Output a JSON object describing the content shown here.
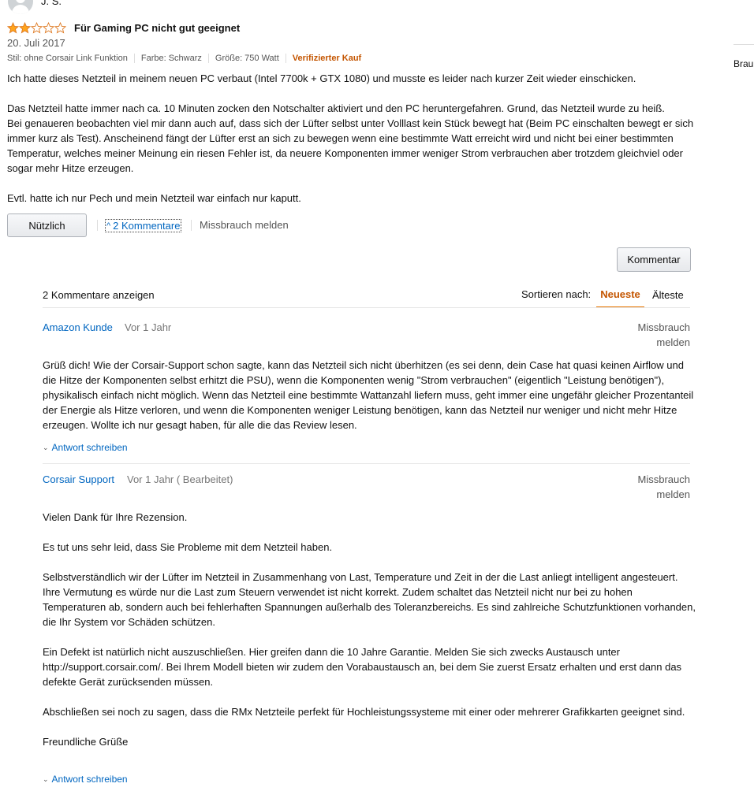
{
  "review": {
    "author": "J. S.",
    "rating": 2,
    "rating_max": 5,
    "title": "Für Gaming PC nicht gut geeignet",
    "date": "20. Juli 2017",
    "meta": {
      "style": "Stil: ohne Corsair Link Funktion",
      "color": "Farbe: Schwarz",
      "size": "Größe: 750 Watt",
      "verified": "Verifizierter Kauf"
    },
    "paragraphs": [
      "Ich hatte dieses Netzteil in meinem neuen PC verbaut (Intel 7700k + GTX 1080) und musste es leider nach kurzer Zeit wieder einschicken.",
      "Das Netzteil hatte immer nach ca. 10 Minuten zocken den Notschalter aktiviert und den PC heruntergefahren. Grund, das Netzteil wurde zu heiß.\nBei genaueren beobachten viel mir dann auch auf, dass sich der Lüfter selbst unter Volllast kein Stück bewegt hat (Beim PC einschalten bewegt er sich immer kurz als Test). Anscheinend fängt der Lüfter erst an sich zu bewegen wenn eine bestimmte Watt erreicht wird und nicht bei einer bestimmten Temperatur, welches meiner Meinung ein riesen Fehler ist, da neuere Komponenten immer weniger Strom verbrauchen aber trotzdem gleichviel oder sogar mehr Hitze erzeugen.",
      "Evtl. hatte ich nur Pech und mein Netzteil war einfach nur kaputt."
    ],
    "helpful_label": "Nützlich",
    "comments_link": "2 Kommentare",
    "report_label": "Missbrauch melden",
    "comment_button": "Kommentar"
  },
  "sidebar": {
    "partial_text": "Brau"
  },
  "comments_section": {
    "count_label": "2 Kommentare anzeigen",
    "sort_label": "Sortieren nach:",
    "sort_newest": "Neueste",
    "sort_oldest": "Älteste",
    "comments": [
      {
        "author": "Amazon Kunde",
        "time": "Vor 1 Jahr",
        "report_line1": "Missbrauch",
        "report_line2": "melden",
        "paragraphs": [
          "Grüß dich! Wie der Corsair-Support schon sagte, kann das Netzteil sich nicht überhitzen (es sei denn, dein Case hat quasi keinen Airflow und die Hitze der Komponenten selbst erhitzt die PSU), wenn die Komponenten wenig \"Strom verbrauchen\" (eigentlich \"Leistung benötigen\"), physikalisch einfach nicht möglich. Wenn das Netzteil eine bestimmte Wattanzahl liefern muss, geht immer eine ungefähr gleicher Prozentanteil der Energie als Hitze verloren, und wenn die Komponenten weniger Leistung benötigen, kann das Netzteil nur weniger und nicht mehr Hitze erzeugen. Wollte ich nur gesagt haben, für alle die das Review lesen."
        ],
        "reply_label": "Antwort schreiben"
      },
      {
        "author": "Corsair Support",
        "time": "Vor 1 Jahr ( Bearbeitet)",
        "report_line1": "Missbrauch",
        "report_line2": "melden",
        "paragraphs": [
          "Vielen Dank für Ihre Rezension.",
          "Es tut uns sehr leid, dass Sie Probleme mit dem Netzteil haben.",
          "Selbstverständlich wir der Lüfter im Netzteil in Zusammenhang von Last, Temperature und Zeit in der die Last anliegt intelligent angesteuert. Ihre Vermutung es würde nur die Last zum Steuern verwendet ist nicht korrekt. Zudem schaltet das Netzteil nicht nur bei zu hohen Temperaturen ab, sondern auch bei fehlerhaften Spannungen außerhalb des Toleranzbereichs. Es sind zahlreiche Schutzfunktionen vorhanden, die Ihr System vor Schäden schützen.",
          "Ein Defekt ist natürlich nicht auszuschließen. Hier greifen dann die 10 Jahre Garantie. Melden Sie sich zwecks Austausch unter http://support.corsair.com/. Bei Ihrem Modell bieten wir zudem den Vorabaustausch an, bei dem Sie zuerst Ersatz erhalten und erst dann das defekte Gerät zurücksenden müssen.",
          "Abschließen sei noch zu sagen, dass die RMx Netzteile perfekt für Hochleistungssysteme mit einer oder mehrerer Grafikkarten geeignet sind.",
          "Freundliche Grüße"
        ],
        "reply_label": "Antwort schreiben"
      }
    ]
  },
  "colors": {
    "link": "#0066c0",
    "accent": "#c45500",
    "star": "#ffa41c"
  }
}
